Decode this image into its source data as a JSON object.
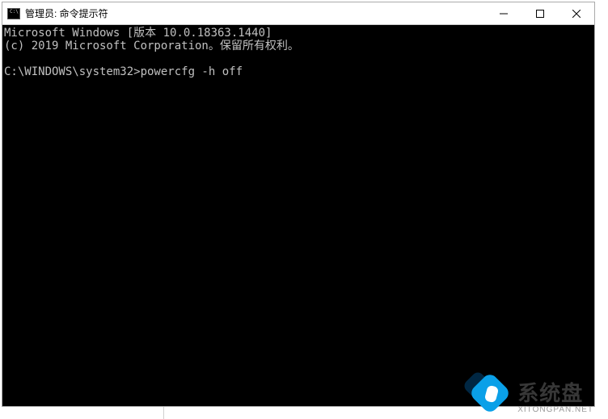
{
  "window": {
    "title": "管理员: 命令提示符"
  },
  "terminal": {
    "line1": "Microsoft Windows [版本 10.0.18363.1440]",
    "line2": "(c) 2019 Microsoft Corporation。保留所有权利。",
    "blank": "",
    "prompt_path": "C:\\WINDOWS\\system32>",
    "command": "powercfg -h off"
  },
  "watermark": {
    "title": "系统盘",
    "subtitle": "XITONGPAN.NET"
  }
}
